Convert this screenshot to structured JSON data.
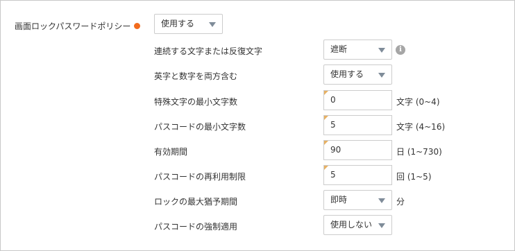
{
  "policy": {
    "label": "画面ロックパスワードポリシー",
    "required_color": "#f26b1d",
    "value": "使用する"
  },
  "settings": [
    {
      "label": "連続する文字または反復文字",
      "control": "select",
      "value": "遮断",
      "info_icon": "info-icon"
    },
    {
      "label": "英字と数字を両方含む",
      "control": "select",
      "value": "使用する"
    },
    {
      "label": "特殊文字の最小文字数",
      "control": "input",
      "value": "0",
      "unit": "文字 (0~4)"
    },
    {
      "label": "パスコードの最小文字数",
      "control": "input",
      "value": "5",
      "unit": "文字 (4~16)"
    },
    {
      "label": "有効期間",
      "control": "input",
      "value": "90",
      "unit": "日 (1~730)"
    },
    {
      "label": "パスコードの再利用制限",
      "control": "input",
      "value": "5",
      "unit": "回 (1~5)"
    },
    {
      "label": "ロックの最大猶予期間",
      "control": "select",
      "value": "即時",
      "unit": "分"
    },
    {
      "label": "パスコードの強制適用",
      "control": "select",
      "value": "使用しない"
    }
  ]
}
